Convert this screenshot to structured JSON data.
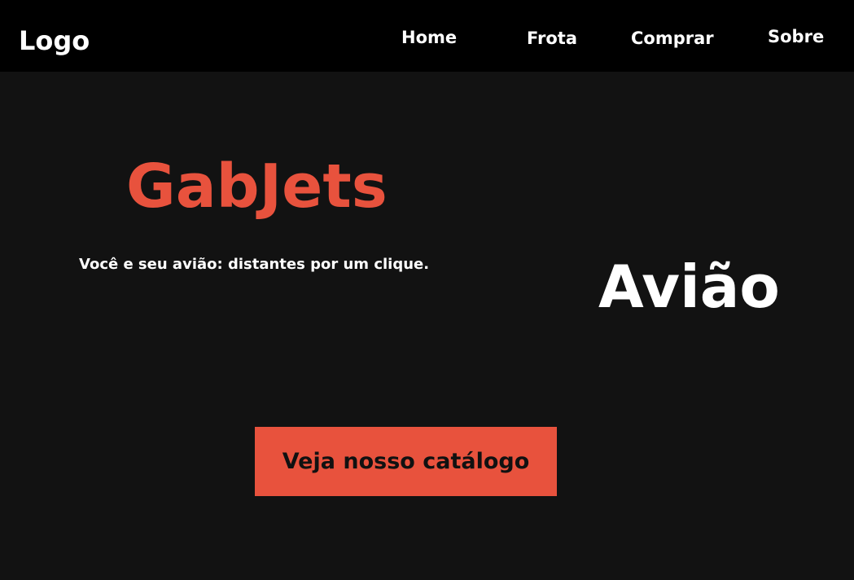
{
  "header": {
    "logo": "Logo",
    "nav": {
      "home": "Home",
      "frota": "Frota",
      "comprar": "Comprar",
      "sobre": "Sobre"
    }
  },
  "hero": {
    "title": "GabJets",
    "subtitle": "Você e seu avião: distantes por um clique.",
    "image_placeholder": "Avião",
    "cta_label": "Veja nosso catálogo"
  },
  "colors": {
    "accent": "#e8523d",
    "background": "#121212",
    "header_background": "#000000",
    "text": "#ffffff"
  }
}
